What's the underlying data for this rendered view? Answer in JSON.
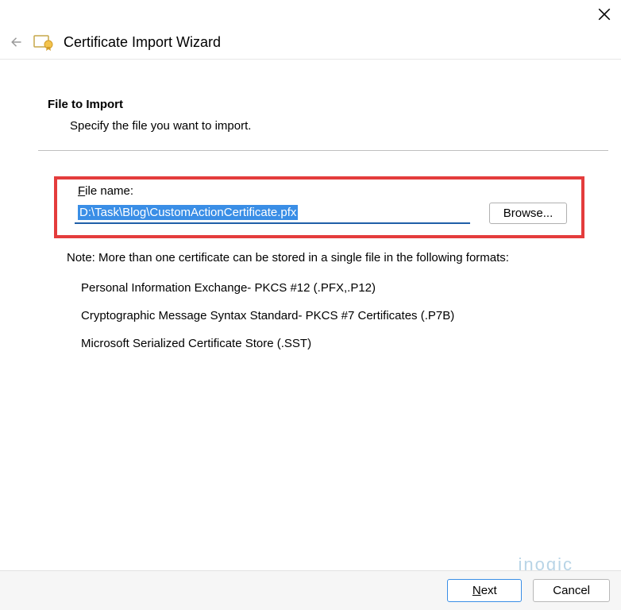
{
  "window": {
    "title": "Certificate Import Wizard"
  },
  "section": {
    "heading": "File to Import",
    "description": "Specify the file you want to import."
  },
  "file": {
    "label_prefix": "F",
    "label_rest": "ile name:",
    "value": "D:\\Task\\Blog\\CustomActionCertificate.pfx",
    "browse_label": "Browse..."
  },
  "note": {
    "intro": "Note:  More than one certificate can be stored in a single file in the following formats:",
    "items": [
      "Personal Information Exchange- PKCS #12 (.PFX,.P12)",
      "Cryptographic Message Syntax Standard- PKCS #7 Certificates (.P7B)",
      "Microsoft Serialized Certificate Store (.SST)"
    ]
  },
  "buttons": {
    "next_prefix": "N",
    "next_rest": "ext",
    "cancel": "Cancel"
  },
  "watermark": "inogic"
}
